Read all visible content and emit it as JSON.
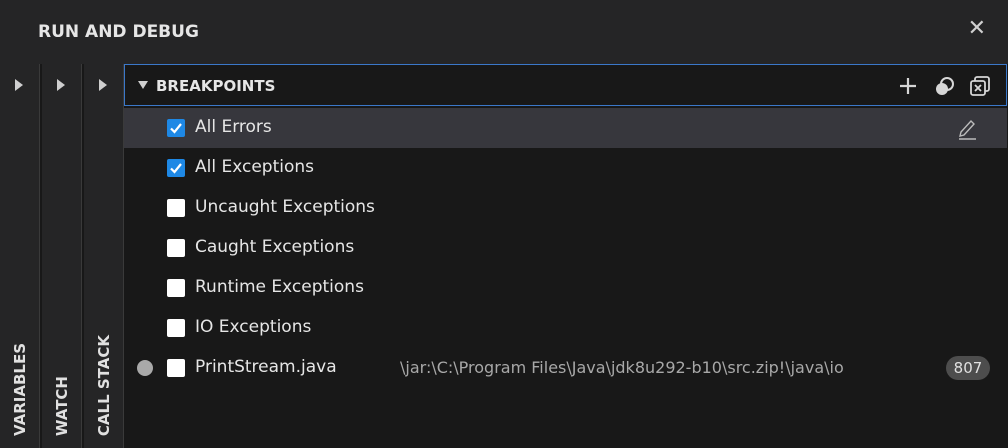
{
  "header": {
    "title": "RUN AND DEBUG",
    "close_icon": "close-icon"
  },
  "side_sections": [
    {
      "label": "VARIABLES"
    },
    {
      "label": "WATCH"
    },
    {
      "label": "CALL STACK"
    }
  ],
  "breakpoints": {
    "title": "BREAKPOINTS",
    "actions": [
      "add-icon",
      "toggle-activate-icon",
      "remove-all-icon"
    ],
    "items": [
      {
        "label": "All Errors",
        "checked": true,
        "selected": true
      },
      {
        "label": "All Exceptions",
        "checked": true
      },
      {
        "label": "Uncaught Exceptions",
        "checked": false
      },
      {
        "label": "Caught Exceptions",
        "checked": false
      },
      {
        "label": "Runtime Exceptions",
        "checked": false
      },
      {
        "label": "IO Exceptions",
        "checked": false
      },
      {
        "label": "PrintStream.java",
        "checked": false,
        "path": "\\jar:\\C:\\Program Files\\Java\\jdk8u292-b10\\src.zip!\\java\\io",
        "line": "807"
      }
    ]
  },
  "colors": {
    "accent": "#1e88e5",
    "focus_border": "#3b78c9",
    "background": "#181818",
    "selected_row": "#37373d"
  }
}
